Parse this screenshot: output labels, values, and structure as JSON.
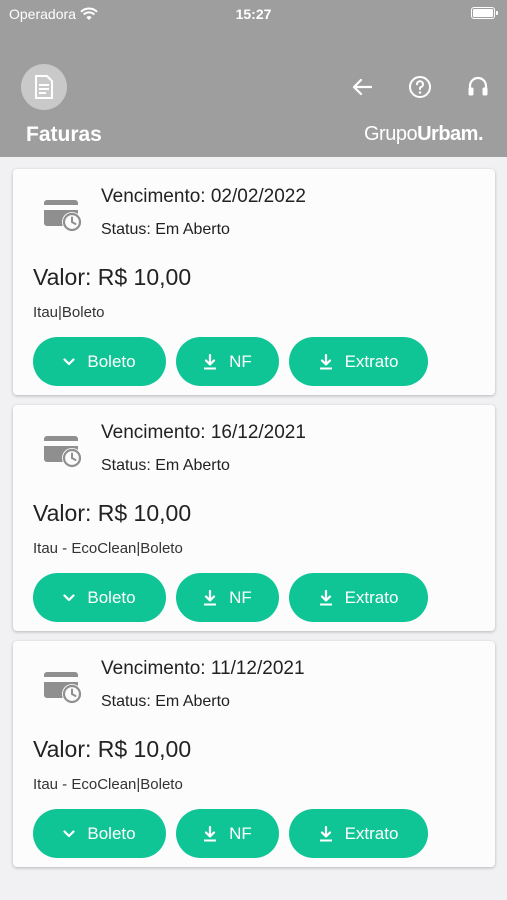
{
  "status_bar": {
    "carrier": "Operadora",
    "time": "15:27"
  },
  "header": {
    "title": "Faturas",
    "brand_light": "Grupo",
    "brand_bold": "Urbam."
  },
  "invoices": [
    {
      "due_label": "Vencimento: 02/02/2022",
      "status_label": "Status: Em Aberto",
      "amount_label": "Valor: R$ 10,00",
      "bank": "Itau|Boleto",
      "boleto_label": "Boleto",
      "nf_label": "NF",
      "extrato_label": "Extrato"
    },
    {
      "due_label": "Vencimento: 16/12/2021",
      "status_label": "Status: Em Aberto",
      "amount_label": "Valor: R$ 10,00",
      "bank": "Itau - EcoClean|Boleto",
      "boleto_label": "Boleto",
      "nf_label": "NF",
      "extrato_label": "Extrato"
    },
    {
      "due_label": "Vencimento: 11/12/2021",
      "status_label": "Status: Em Aberto",
      "amount_label": "Valor: R$ 10,00",
      "bank": "Itau - EcoClean|Boleto",
      "boleto_label": "Boleto",
      "nf_label": "NF",
      "extrato_label": "Extrato"
    }
  ],
  "colors": {
    "header_bg": "#9e9e9e",
    "accent": "#10c595",
    "card_bg": "#fcfcfd",
    "page_bg": "#f1f1f3"
  },
  "icons": {
    "header": [
      "document-icon",
      "back-arrow-icon",
      "help-icon",
      "headset-icon"
    ],
    "card": "card-clock-icon",
    "buttons": [
      "chevron-down-icon",
      "download-icon",
      "download-icon"
    ]
  }
}
